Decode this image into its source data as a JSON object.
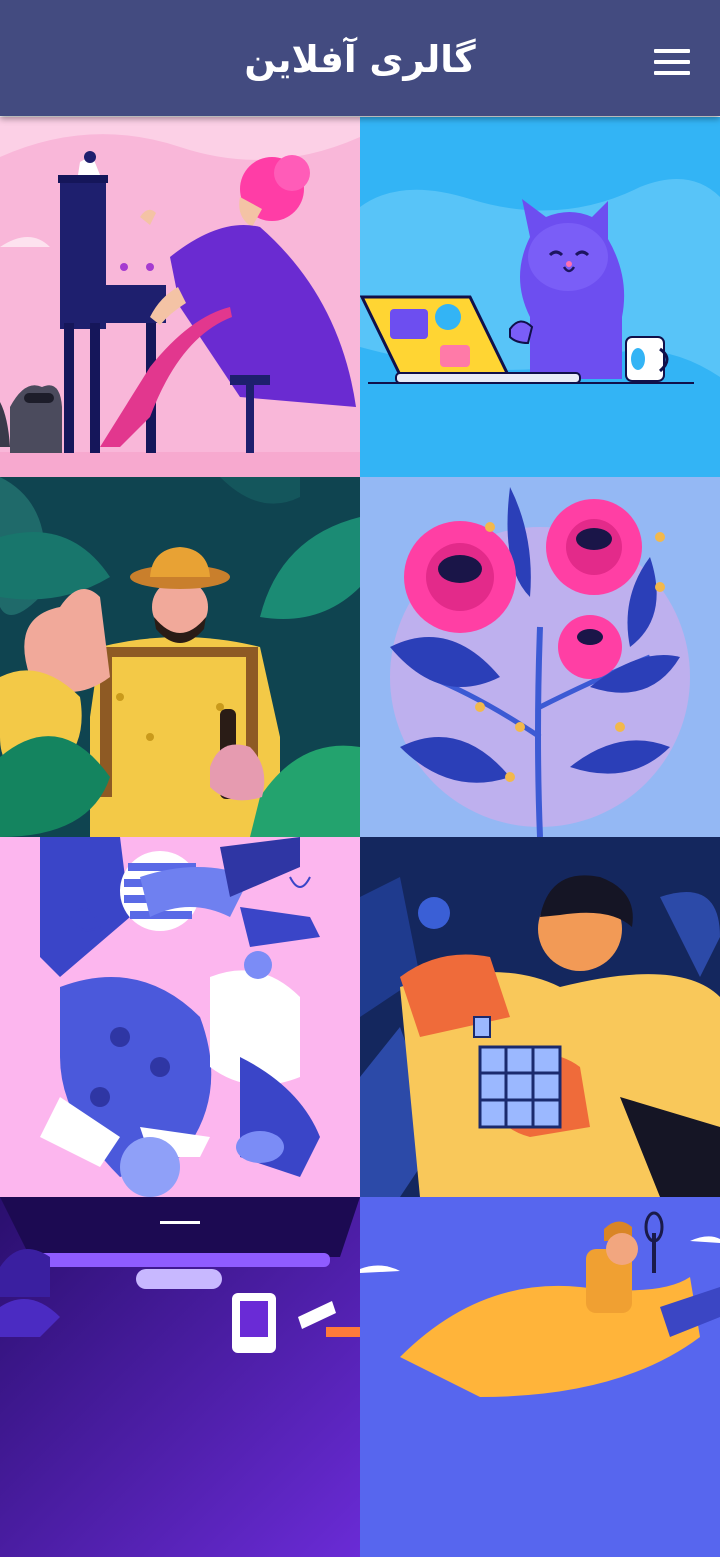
{
  "app_bar": {
    "title": "گالری آفلاین",
    "menu_icon": "hamburger-menu-icon",
    "background": "#434b80"
  },
  "gallery": {
    "images": [
      {
        "name": "pianist-illustration",
        "background": "#f9b7d9"
      },
      {
        "name": "cat-laptop-illustration",
        "background": "#33b4f5"
      },
      {
        "name": "jungle-explorer-illustration",
        "background": "#0f4450"
      },
      {
        "name": "peony-flowers-illustration",
        "background": "#94b8f4"
      },
      {
        "name": "abstract-people-illustration",
        "background": "#fcb6ee"
      },
      {
        "name": "rubiks-cube-illustration",
        "background": "#14275e"
      },
      {
        "name": "ui-devices-illustration",
        "background": "#3d1a9c"
      },
      {
        "name": "explorer-magnifier-illustration",
        "background": "#5766ee"
      }
    ]
  }
}
